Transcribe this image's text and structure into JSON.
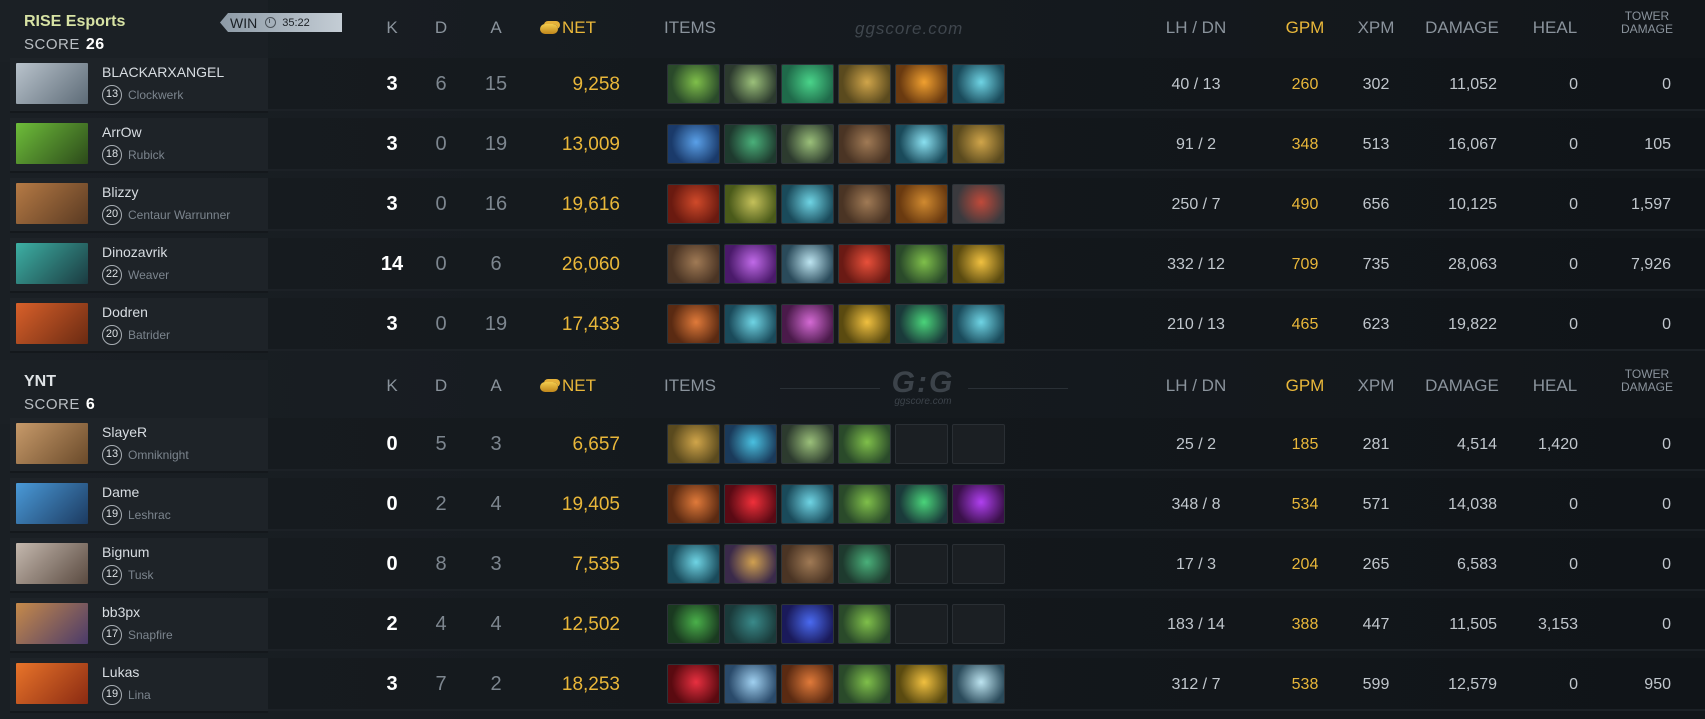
{
  "colors": {
    "gold": "#e9b73a",
    "team_name": "#d7e2a4",
    "background": "#14181c"
  },
  "headers": {
    "k": "K",
    "d": "D",
    "a": "A",
    "net": "NET",
    "items": "ITEMS",
    "lhdn": "LH  /  DN",
    "gpm": "GPM",
    "xpm": "XPM",
    "damage": "DAMAGE",
    "heal": "HEAL",
    "tower_line1": "TOWER",
    "tower_line2": "DAMAGE",
    "watermark_text": "ggscore.com",
    "watermark_logo": "G:G",
    "watermark_logo_sub": "ggscore.com"
  },
  "radiant": {
    "name": "RISE Esports",
    "score_label": "SCORE",
    "score": "26",
    "result": "WIN",
    "duration": "35:22",
    "players": [
      {
        "name": "BLACKARXANGEL",
        "level": "13",
        "hero": "Clockwerk",
        "k": "3",
        "d": "6",
        "a": "15",
        "net": "9,258",
        "lhdn": "40  /  13",
        "gpm": "260",
        "xpm": "302",
        "damage": "11,052",
        "heal": "0",
        "tower": "0",
        "items": [
          "iron-branch",
          "quelling-blade",
          "tranquil-boots",
          "urn",
          "mango",
          "wind-lace"
        ],
        "portrait": [
          "#b9c3cc",
          "#5d6b77"
        ]
      },
      {
        "name": "ArrOw",
        "level": "18",
        "hero": "Rubick",
        "k": "3",
        "d": "0",
        "a": "19",
        "net": "13,009",
        "lhdn": "91  /  2",
        "gpm": "348",
        "xpm": "513",
        "damage": "16,067",
        "heal": "0",
        "tower": "105",
        "items": [
          "glimmer-cape",
          "blink-dagger",
          "quelling-blade",
          "boots",
          "force-staff",
          "urn"
        ],
        "portrait": [
          "#6ebd3a",
          "#2c4a1a"
        ]
      },
      {
        "name": "Blizzy",
        "level": "20",
        "hero": "Centaur Warrunner",
        "k": "3",
        "d": "0",
        "a": "16",
        "net": "19,616",
        "lhdn": "250  /  7",
        "gpm": "490",
        "xpm": "656",
        "damage": "10,125",
        "heal": "0",
        "tower": "1,597",
        "items": [
          "heart",
          "pipe",
          "wind-lace",
          "boots",
          "mask",
          "armor"
        ],
        "portrait": [
          "#b57a45",
          "#5a3a22"
        ]
      },
      {
        "name": "Dinozavrik",
        "level": "22",
        "hero": "Weaver",
        "k": "14",
        "d": "0",
        "a": "6",
        "net": "26,060",
        "lhdn": "332  /  12",
        "gpm": "709",
        "xpm": "735",
        "damage": "28,063",
        "heal": "0",
        "tower": "7,926",
        "items": [
          "boots",
          "orchid",
          "skadi",
          "sange",
          "iron-branch",
          "helm"
        ],
        "portrait": [
          "#3db0a4",
          "#1b3a40"
        ]
      },
      {
        "name": "Dodren",
        "level": "20",
        "hero": "Batrider",
        "k": "3",
        "d": "0",
        "a": "19",
        "net": "17,433",
        "lhdn": "210  /  13",
        "gpm": "465",
        "xpm": "623",
        "damage": "19,822",
        "heal": "0",
        "tower": "0",
        "items": [
          "cloak",
          "wind-lace",
          "orb",
          "helm",
          "lotus",
          "wind-lace"
        ],
        "portrait": [
          "#d8602a",
          "#6a2a12"
        ]
      }
    ]
  },
  "dire": {
    "name": "YNT",
    "score_label": "SCORE",
    "score": "6",
    "players": [
      {
        "name": "SlayeR",
        "level": "13",
        "hero": "Omniknight",
        "k": "0",
        "d": "5",
        "a": "3",
        "net": "6,657",
        "lhdn": "25  /  2",
        "gpm": "185",
        "xpm": "281",
        "damage": "4,514",
        "heal": "1,420",
        "tower": "0",
        "items": [
          "urn",
          "arcane",
          "quelling-blade",
          "iron-branch",
          "empty",
          "empty"
        ],
        "portrait": [
          "#c79a6a",
          "#6a4a2a"
        ]
      },
      {
        "name": "Dame",
        "level": "19",
        "hero": "Leshrac",
        "k": "0",
        "d": "2",
        "a": "4",
        "net": "19,405",
        "lhdn": "348  /  8",
        "gpm": "534",
        "xpm": "571",
        "damage": "14,038",
        "heal": "0",
        "tower": "0",
        "items": [
          "cloak",
          "bloodstone",
          "wind-lace",
          "iron-branch",
          "lotus",
          "dagon"
        ],
        "portrait": [
          "#4a9ad8",
          "#1c3a60"
        ]
      },
      {
        "name": "Bignum",
        "level": "12",
        "hero": "Tusk",
        "k": "0",
        "d": "8",
        "a": "3",
        "net": "7,535",
        "lhdn": "17  /  3",
        "gpm": "204",
        "xpm": "265",
        "damage": "6,583",
        "heal": "0",
        "tower": "0",
        "items": [
          "wind-lace",
          "smoke",
          "boots",
          "blink-dagger",
          "empty",
          "empty"
        ],
        "portrait": [
          "#c4b8ae",
          "#5a4a40"
        ]
      },
      {
        "name": "bb3px",
        "level": "17",
        "hero": "Snapfire",
        "k": "2",
        "d": "4",
        "a": "4",
        "net": "12,502",
        "lhdn": "183  /  14",
        "gpm": "388",
        "xpm": "447",
        "damage": "11,505",
        "heal": "3,153",
        "tower": "0",
        "items": [
          "ward",
          "vest",
          "scepter",
          "iron-branch",
          "empty",
          "empty"
        ],
        "portrait": [
          "#c68a4a",
          "#4a3a6a"
        ]
      },
      {
        "name": "Lukas",
        "level": "19",
        "hero": "Lina",
        "k": "3",
        "d": "7",
        "a": "2",
        "net": "18,253",
        "lhdn": "312  /  7",
        "gpm": "538",
        "xpm": "599",
        "damage": "12,579",
        "heal": "0",
        "tower": "950",
        "items": [
          "claw",
          "sword",
          "cloak",
          "iron-branch",
          "helm",
          "skadi"
        ],
        "portrait": [
          "#e8742a",
          "#8a2a12"
        ]
      }
    ]
  }
}
